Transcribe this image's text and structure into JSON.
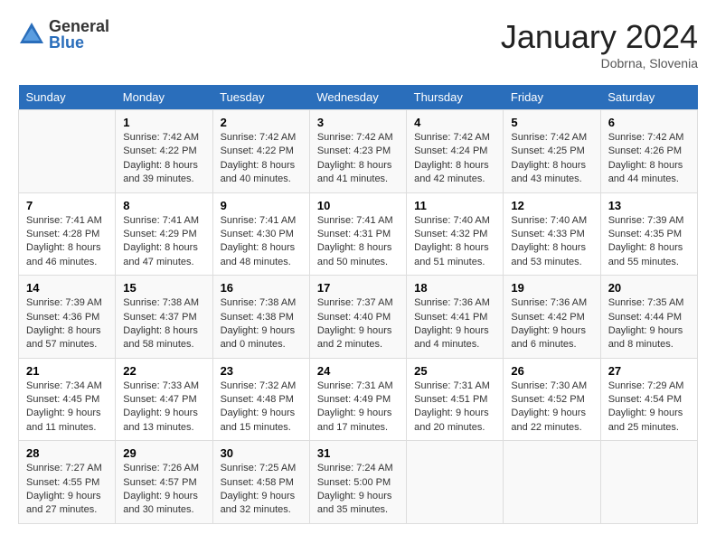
{
  "header": {
    "logo_general": "General",
    "logo_blue": "Blue",
    "month_title": "January 2024",
    "location": "Dobrna, Slovenia"
  },
  "days_of_week": [
    "Sunday",
    "Monday",
    "Tuesday",
    "Wednesday",
    "Thursday",
    "Friday",
    "Saturday"
  ],
  "weeks": [
    [
      {
        "day": "",
        "info": ""
      },
      {
        "day": "1",
        "info": "Sunrise: 7:42 AM\nSunset: 4:22 PM\nDaylight: 8 hours\nand 39 minutes."
      },
      {
        "day": "2",
        "info": "Sunrise: 7:42 AM\nSunset: 4:22 PM\nDaylight: 8 hours\nand 40 minutes."
      },
      {
        "day": "3",
        "info": "Sunrise: 7:42 AM\nSunset: 4:23 PM\nDaylight: 8 hours\nand 41 minutes."
      },
      {
        "day": "4",
        "info": "Sunrise: 7:42 AM\nSunset: 4:24 PM\nDaylight: 8 hours\nand 42 minutes."
      },
      {
        "day": "5",
        "info": "Sunrise: 7:42 AM\nSunset: 4:25 PM\nDaylight: 8 hours\nand 43 minutes."
      },
      {
        "day": "6",
        "info": "Sunrise: 7:42 AM\nSunset: 4:26 PM\nDaylight: 8 hours\nand 44 minutes."
      }
    ],
    [
      {
        "day": "7",
        "info": "Sunrise: 7:41 AM\nSunset: 4:28 PM\nDaylight: 8 hours\nand 46 minutes."
      },
      {
        "day": "8",
        "info": "Sunrise: 7:41 AM\nSunset: 4:29 PM\nDaylight: 8 hours\nand 47 minutes."
      },
      {
        "day": "9",
        "info": "Sunrise: 7:41 AM\nSunset: 4:30 PM\nDaylight: 8 hours\nand 48 minutes."
      },
      {
        "day": "10",
        "info": "Sunrise: 7:41 AM\nSunset: 4:31 PM\nDaylight: 8 hours\nand 50 minutes."
      },
      {
        "day": "11",
        "info": "Sunrise: 7:40 AM\nSunset: 4:32 PM\nDaylight: 8 hours\nand 51 minutes."
      },
      {
        "day": "12",
        "info": "Sunrise: 7:40 AM\nSunset: 4:33 PM\nDaylight: 8 hours\nand 53 minutes."
      },
      {
        "day": "13",
        "info": "Sunrise: 7:39 AM\nSunset: 4:35 PM\nDaylight: 8 hours\nand 55 minutes."
      }
    ],
    [
      {
        "day": "14",
        "info": "Sunrise: 7:39 AM\nSunset: 4:36 PM\nDaylight: 8 hours\nand 57 minutes."
      },
      {
        "day": "15",
        "info": "Sunrise: 7:38 AM\nSunset: 4:37 PM\nDaylight: 8 hours\nand 58 minutes."
      },
      {
        "day": "16",
        "info": "Sunrise: 7:38 AM\nSunset: 4:38 PM\nDaylight: 9 hours\nand 0 minutes."
      },
      {
        "day": "17",
        "info": "Sunrise: 7:37 AM\nSunset: 4:40 PM\nDaylight: 9 hours\nand 2 minutes."
      },
      {
        "day": "18",
        "info": "Sunrise: 7:36 AM\nSunset: 4:41 PM\nDaylight: 9 hours\nand 4 minutes."
      },
      {
        "day": "19",
        "info": "Sunrise: 7:36 AM\nSunset: 4:42 PM\nDaylight: 9 hours\nand 6 minutes."
      },
      {
        "day": "20",
        "info": "Sunrise: 7:35 AM\nSunset: 4:44 PM\nDaylight: 9 hours\nand 8 minutes."
      }
    ],
    [
      {
        "day": "21",
        "info": "Sunrise: 7:34 AM\nSunset: 4:45 PM\nDaylight: 9 hours\nand 11 minutes."
      },
      {
        "day": "22",
        "info": "Sunrise: 7:33 AM\nSunset: 4:47 PM\nDaylight: 9 hours\nand 13 minutes."
      },
      {
        "day": "23",
        "info": "Sunrise: 7:32 AM\nSunset: 4:48 PM\nDaylight: 9 hours\nand 15 minutes."
      },
      {
        "day": "24",
        "info": "Sunrise: 7:31 AM\nSunset: 4:49 PM\nDaylight: 9 hours\nand 17 minutes."
      },
      {
        "day": "25",
        "info": "Sunrise: 7:31 AM\nSunset: 4:51 PM\nDaylight: 9 hours\nand 20 minutes."
      },
      {
        "day": "26",
        "info": "Sunrise: 7:30 AM\nSunset: 4:52 PM\nDaylight: 9 hours\nand 22 minutes."
      },
      {
        "day": "27",
        "info": "Sunrise: 7:29 AM\nSunset: 4:54 PM\nDaylight: 9 hours\nand 25 minutes."
      }
    ],
    [
      {
        "day": "28",
        "info": "Sunrise: 7:27 AM\nSunset: 4:55 PM\nDaylight: 9 hours\nand 27 minutes."
      },
      {
        "day": "29",
        "info": "Sunrise: 7:26 AM\nSunset: 4:57 PM\nDaylight: 9 hours\nand 30 minutes."
      },
      {
        "day": "30",
        "info": "Sunrise: 7:25 AM\nSunset: 4:58 PM\nDaylight: 9 hours\nand 32 minutes."
      },
      {
        "day": "31",
        "info": "Sunrise: 7:24 AM\nSunset: 5:00 PM\nDaylight: 9 hours\nand 35 minutes."
      },
      {
        "day": "",
        "info": ""
      },
      {
        "day": "",
        "info": ""
      },
      {
        "day": "",
        "info": ""
      }
    ]
  ]
}
